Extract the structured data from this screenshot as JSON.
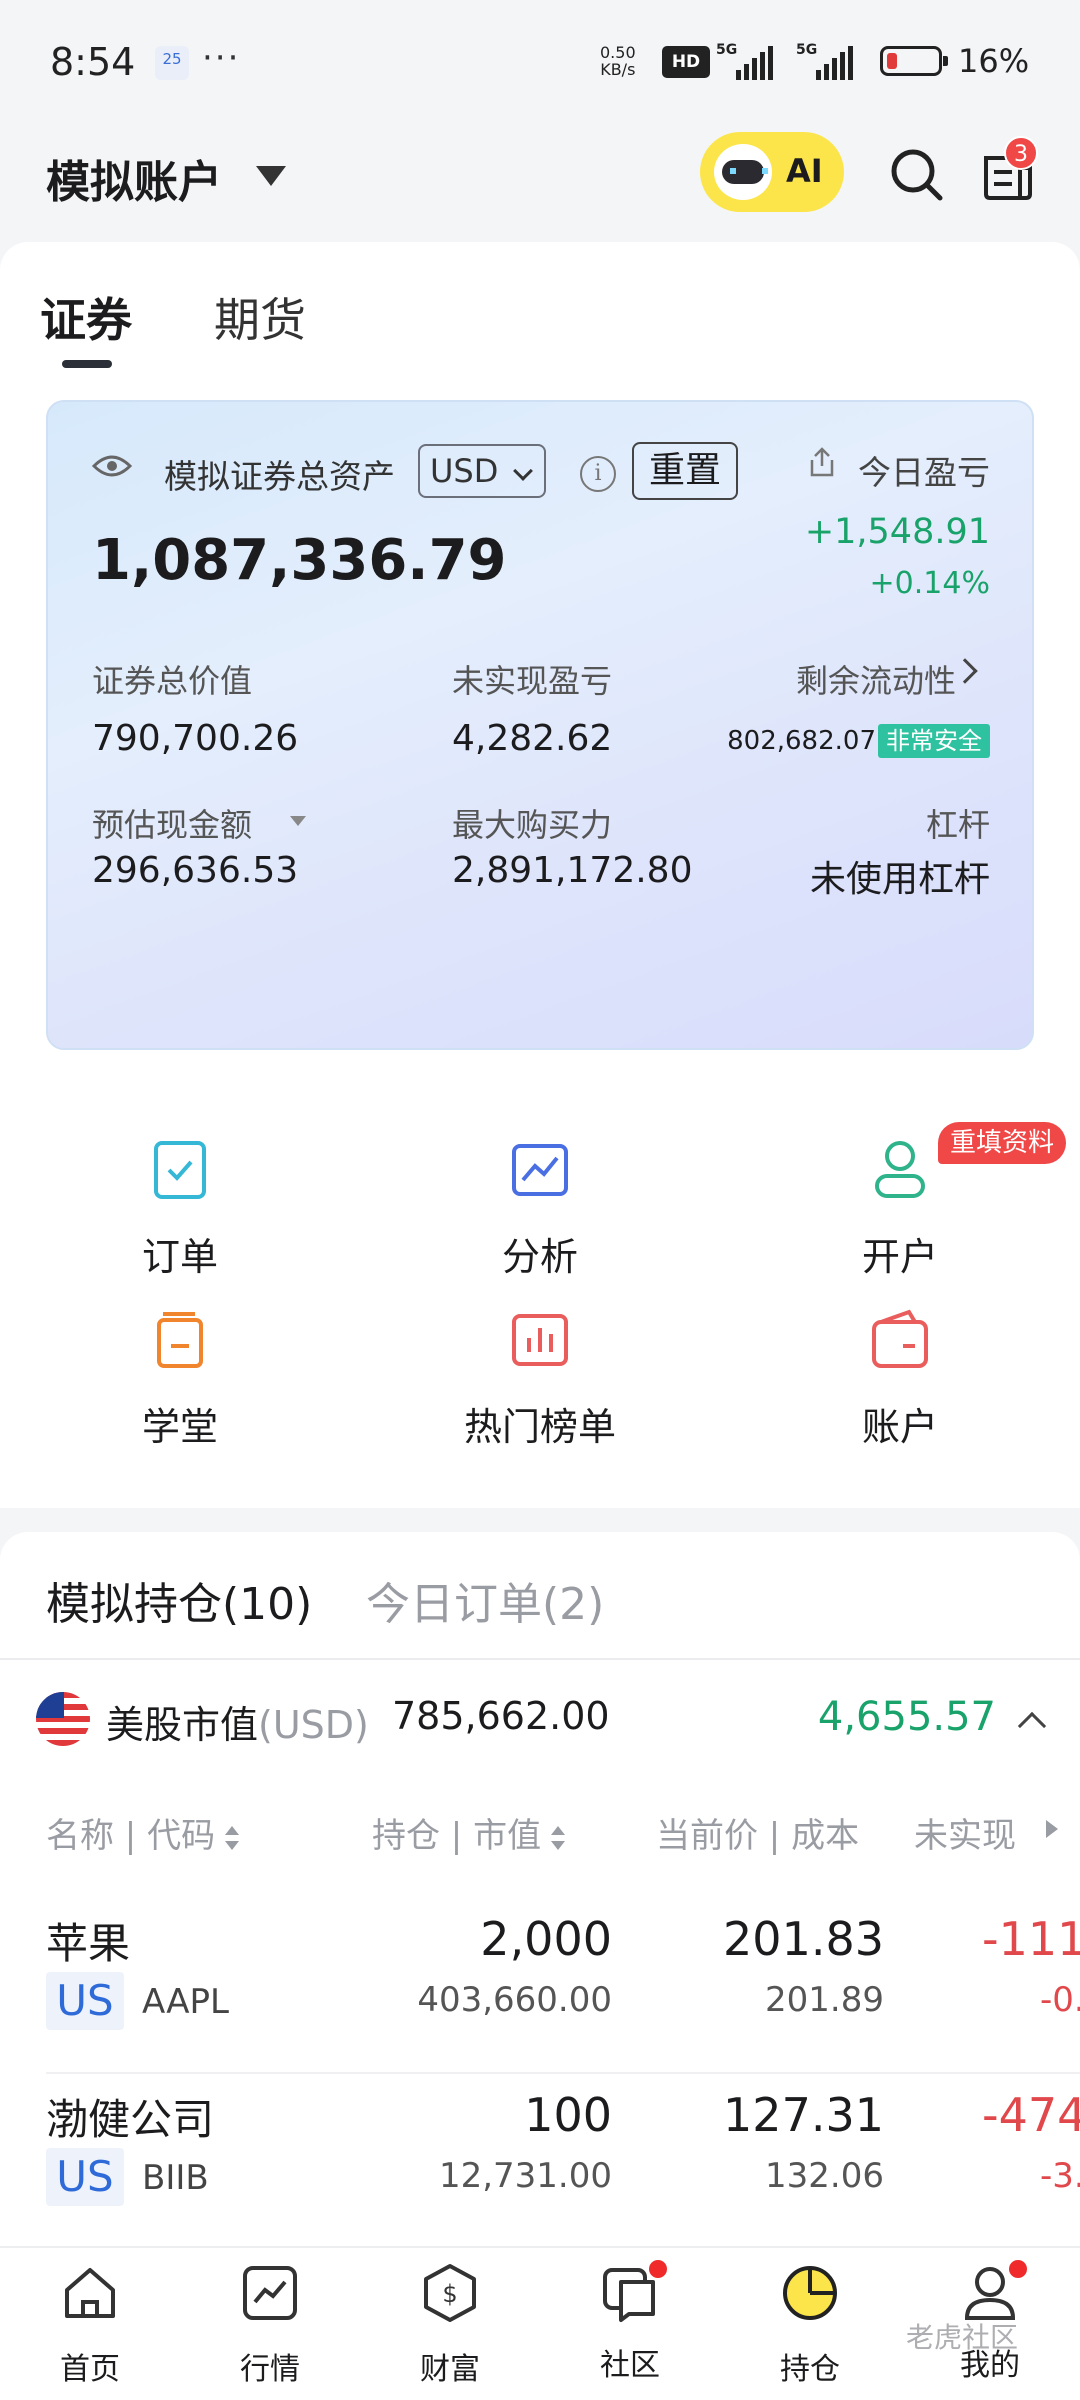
{
  "status_bar": {
    "time": "8:54",
    "calendar_day": "25",
    "more": "···",
    "net_speed_value": "0.50",
    "net_speed_unit": "KB/s",
    "hd": "HD",
    "sim1": "5G",
    "sim2": "5G",
    "battery": "16%"
  },
  "header": {
    "title": "模拟账户",
    "ai_label": "AI",
    "notification_count": "3"
  },
  "tabs": {
    "stock": "证券",
    "futures": "期货"
  },
  "account_card": {
    "label": "模拟证券总资产",
    "currency": "USD",
    "info": "i",
    "reset": "重置",
    "today_label": "今日盈亏",
    "total_assets": "1,087,336.79",
    "today_pl": "+1,548.91",
    "today_pl_pct": "+0.14%",
    "metrics": {
      "securities_value_label": "证券总价值",
      "securities_value": "790,700.26",
      "unrealized_label": "未实现盈亏",
      "unrealized": "4,282.62",
      "liquidity_label": "剩余流动性",
      "liquidity": "802,682.07",
      "liquidity_badge": "非常安全",
      "cash_label": "预估现金额",
      "cash": "296,636.53",
      "buying_power_label": "最大购买力",
      "buying_power": "2,891,172.80",
      "leverage_label": "杠杆",
      "leverage": "未使用杠杆"
    }
  },
  "quick_actions": {
    "orders": "订单",
    "analysis": "分析",
    "open_account": "开户",
    "open_account_badge": "重填资料",
    "academy": "学堂",
    "hot_lists": "热门榜单",
    "account": "账户"
  },
  "holdings": {
    "tab_positions": "模拟持仓(10)",
    "tab_orders": "今日订单(2)",
    "market_label": "美股市值",
    "market_currency": "(USD)",
    "market_value": "785,662.00",
    "market_gain": "4,655.57",
    "columns": {
      "name": "名称 | 代码",
      "position": "持仓 | 市值",
      "price": "当前价 | 成本",
      "unrealized": "未实现"
    },
    "rows": [
      {
        "name": "苹果",
        "market": "US",
        "code": "AAPL",
        "qty": "2,000",
        "market_value": "403,660.00",
        "price": "201.83",
        "cost": "201.89",
        "unrealized": "-111",
        "unrealized_pct": "-0."
      },
      {
        "name": "渤健公司",
        "market": "US",
        "code": "BIIB",
        "qty": "100",
        "market_value": "12,731.00",
        "price": "127.31",
        "cost": "132.06",
        "unrealized": "-474",
        "unrealized_pct": "-3."
      }
    ]
  },
  "bottom_nav": {
    "home": "首页",
    "market": "行情",
    "wealth": "财富",
    "community": "社区",
    "holdings": "持仓",
    "me": "我的"
  },
  "watermark": "老虎社区",
  "colors": {
    "gain": "#19a36a",
    "loss": "#e0484b",
    "ai_yellow": "#fbe54b",
    "badge_red": "#f04747",
    "safe_green": "#2fc2a0",
    "market_tag_blue": "#2f6bd8"
  }
}
